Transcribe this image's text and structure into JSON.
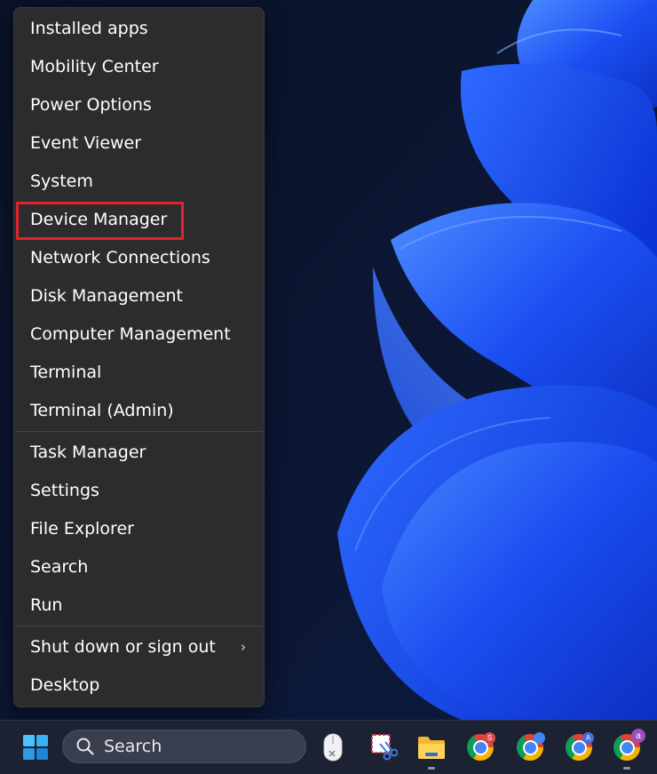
{
  "menu": {
    "items": [
      {
        "label": "Installed apps"
      },
      {
        "label": "Mobility Center"
      },
      {
        "label": "Power Options"
      },
      {
        "label": "Event Viewer"
      },
      {
        "label": "System"
      },
      {
        "label": "Device Manager"
      },
      {
        "label": "Network Connections"
      },
      {
        "label": "Disk Management"
      },
      {
        "label": "Computer Management"
      },
      {
        "label": "Terminal"
      },
      {
        "label": "Terminal (Admin)"
      },
      {
        "label": "Task Manager"
      },
      {
        "label": "Settings"
      },
      {
        "label": "File Explorer"
      },
      {
        "label": "Search"
      },
      {
        "label": "Run"
      },
      {
        "label": "Shut down or sign out",
        "chevron": "›"
      },
      {
        "label": "Desktop"
      }
    ],
    "highlight_color": "#e0242b"
  },
  "taskbar": {
    "search_label": "Search",
    "icons": [
      {
        "name": "start-icon"
      },
      {
        "name": "search-icon"
      },
      {
        "name": "mouse-app-icon"
      },
      {
        "name": "snipping-tool-icon"
      },
      {
        "name": "file-explorer-icon"
      },
      {
        "name": "chrome-icon",
        "badge": "S",
        "badge_color": "#d84b4b"
      },
      {
        "name": "chrome-icon",
        "badge": "",
        "badge_color": "#4285f4"
      },
      {
        "name": "chrome-icon",
        "badge": "A",
        "badge_color": "#3f6fd8"
      },
      {
        "name": "chrome-icon",
        "badge": "a",
        "badge_color": "#9c4fb8"
      }
    ]
  }
}
